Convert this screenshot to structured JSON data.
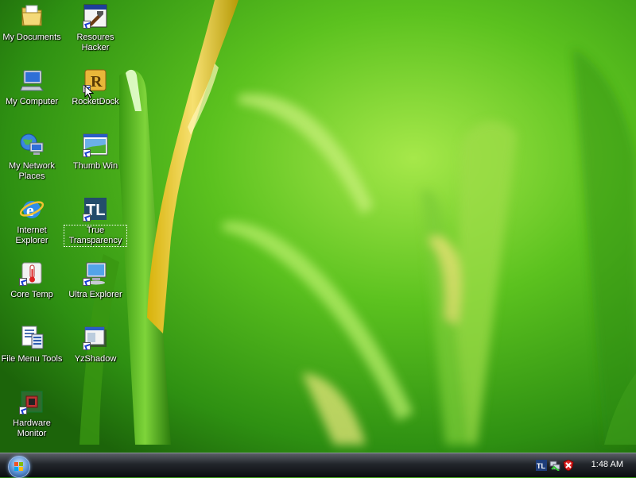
{
  "desktop": {
    "icons": [
      {
        "label": "My Documents",
        "icon": "my-documents-icon"
      },
      {
        "label": "Resoures Hacker",
        "icon": "resource-hacker-icon"
      },
      {
        "label": "My Computer",
        "icon": "my-computer-icon"
      },
      {
        "label": "RocketDock",
        "icon": "rocketdock-icon"
      },
      {
        "label": "My Network Places",
        "icon": "network-places-icon"
      },
      {
        "label": "Thumb Win",
        "icon": "thumb-win-icon"
      },
      {
        "label": "Internet Explorer",
        "icon": "internet-explorer-icon"
      },
      {
        "label": "True Transparency",
        "icon": "true-transparency-icon"
      },
      {
        "label": "Core Temp",
        "icon": "core-temp-icon"
      },
      {
        "label": "Ultra Explorer",
        "icon": "ultra-explorer-icon"
      },
      {
        "label": "File Menu Tools",
        "icon": "file-menu-tools-icon"
      },
      {
        "label": "YzShadow",
        "icon": "yzshadow-icon"
      },
      {
        "label": "Hardware Monitor",
        "icon": "hardware-monitor-icon"
      }
    ],
    "focused_icon": "True Transparency"
  },
  "taskbar": {
    "start_icon": "windows-orb-icon",
    "tray_icons": [
      "true-transparency-tray-icon",
      "network-tray-icon",
      "security-tray-icon"
    ],
    "clock": "1:48 AM"
  },
  "colors": {
    "wallpaper_green": "#4fb81a",
    "taskbar_dark": "#0b0d10",
    "label_text": "#ffffff"
  }
}
